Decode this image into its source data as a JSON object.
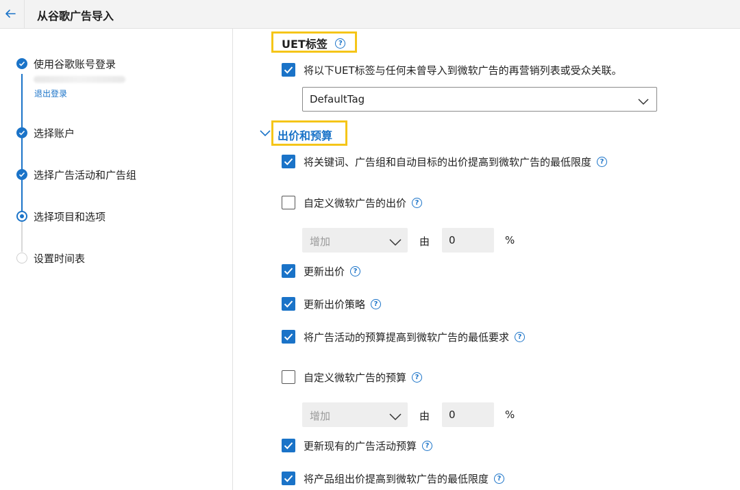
{
  "header": {
    "title": "从谷歌广告导入"
  },
  "steps": [
    {
      "label": "使用谷歌账号登录",
      "status": "done",
      "link": "退出登录"
    },
    {
      "label": "选择账户",
      "status": "done"
    },
    {
      "label": "选择广告活动和广告组",
      "status": "done"
    },
    {
      "label": "选择项目和选项",
      "status": "current"
    },
    {
      "label": "设置时间表",
      "status": "todo"
    }
  ],
  "uet": {
    "title": "UET标签",
    "associate_label": "将以下UET标签与任何未曾导入到微软广告的再营销列表或受众关联。",
    "associate_checked": true,
    "tag_value": "DefaultTag"
  },
  "bidding": {
    "title": "出价和预算",
    "raise_bids_label": "将关键词、广告组和自动目标的出价提高到微软广告的最低限度",
    "raise_bids_checked": true,
    "custom_bid_label": "自定义微软广告的出价",
    "custom_bid_checked": false,
    "custom_bid_mode": "增加",
    "custom_bid_by": "由",
    "custom_bid_value": "0",
    "custom_bid_unit": "%",
    "update_bids_label": "更新出价",
    "update_bids_checked": true,
    "update_strategy_label": "更新出价策略",
    "update_strategy_checked": true,
    "raise_budget_label": "将广告活动的预算提高到微软广告的最低要求",
    "raise_budget_checked": true,
    "custom_budget_label": "自定义微软广告的预算",
    "custom_budget_checked": false,
    "custom_budget_mode": "增加",
    "custom_budget_by": "由",
    "custom_budget_value": "0",
    "custom_budget_unit": "%",
    "update_budget_label": "更新现有的广告活动预算",
    "update_budget_checked": true,
    "raise_adgroup_bids_label": "将产品组出价提高到微软广告的最低限度",
    "raise_adgroup_bids_checked": true
  },
  "colors": {
    "accent": "#1a73c8",
    "highlight": "#f5c518",
    "sidebar_border": "#e1e1e1"
  }
}
